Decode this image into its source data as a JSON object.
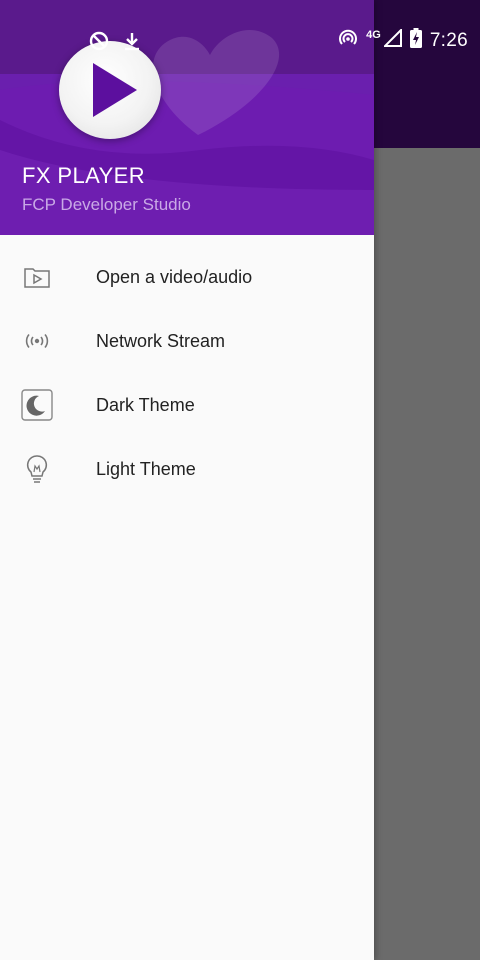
{
  "status_bar": {
    "time": "7:26",
    "network": "4G",
    "icons": [
      "hotspot-icon",
      "download-icon",
      "cast-icon",
      "signal-icon",
      "battery-charging-icon"
    ]
  },
  "drawer": {
    "app_title": "FX PLAYER",
    "app_subtitle": "FCP Developer Studio",
    "menu": [
      {
        "label": "Open a video/audio",
        "icon": "folder-play-icon"
      },
      {
        "label": "Network Stream",
        "icon": "network-stream-icon"
      },
      {
        "label": "Dark Theme",
        "icon": "moon-icon"
      },
      {
        "label": "Light Theme",
        "icon": "lightbulb-icon"
      }
    ]
  },
  "colors": {
    "header_purple": "#6d1cb0",
    "status_dark": "#25063d",
    "scrim": "#6b6b6b",
    "drawer_bg": "#fafafa",
    "logo_play": "#5c0f9e"
  }
}
